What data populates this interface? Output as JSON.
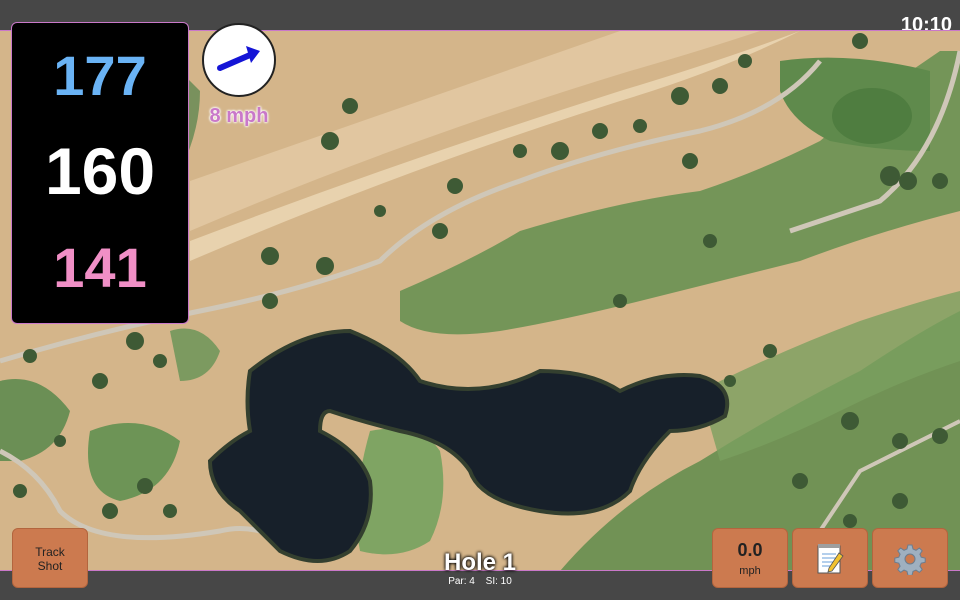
{
  "status": {
    "time": "10:10"
  },
  "distances": {
    "back": "177",
    "middle": "160",
    "front": "141"
  },
  "wind": {
    "direction": "east-northeast",
    "speed_label": "8 mph"
  },
  "hole": {
    "title": "Hole 1",
    "par": "Par: 4",
    "stroke_index": "SI: 10"
  },
  "buttons": {
    "track_shot_line1": "Track",
    "track_shot_line2": "Shot",
    "wind_value": "0.0",
    "wind_unit": "mph",
    "notes_icon": "notepad-icon",
    "settings_icon": "gear-icon"
  },
  "colors": {
    "back_distance": "#6ab3f5",
    "middle_distance": "#ffffff",
    "front_distance": "#f08fc6",
    "button": "#cc7a4f",
    "accent": "#c978c9"
  }
}
